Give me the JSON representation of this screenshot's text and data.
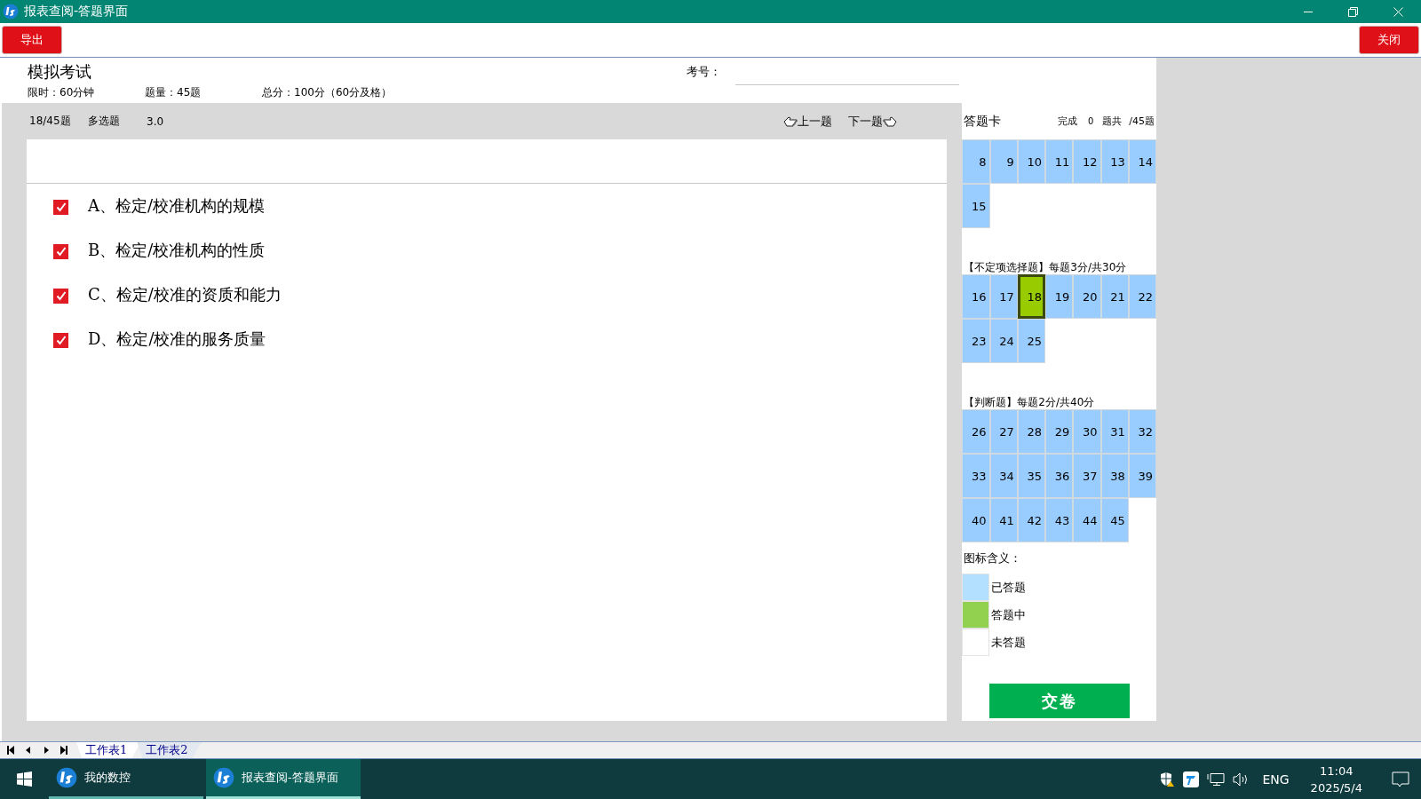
{
  "window": {
    "title": "报表查阅-答题界面"
  },
  "toolbar": {
    "export_button": "导出",
    "close_button": "关闭"
  },
  "exam": {
    "title": "模拟考试",
    "time_limit": "限时：60分钟",
    "question_count": "题量：45题",
    "total_score": "总分：100分（60分及格）",
    "exam_no_label": "考号："
  },
  "question_bar": {
    "position": "18/45题",
    "type": "多选题",
    "score": "3.0",
    "prev": "上一题",
    "next": "下一题"
  },
  "options": [
    {
      "label": "A、检定/校准机构的规模",
      "checked": true
    },
    {
      "label": "B、检定/校准机构的性质",
      "checked": true
    },
    {
      "label": "C、检定/校准的资质和能力",
      "checked": true
    },
    {
      "label": "D、检定/校准的服务质量",
      "checked": true
    }
  ],
  "answer_card": {
    "title": "答题卡",
    "done_label": "完成",
    "done_count": "0",
    "total_label": "题共",
    "total": "/45题",
    "sections": [
      {
        "cells": [
          {
            "number": "8",
            "selected": false
          },
          {
            "number": "9",
            "selected": false
          },
          {
            "number": "10",
            "selected": false
          },
          {
            "number": "11",
            "selected": false
          },
          {
            "number": "12",
            "selected": false
          },
          {
            "number": "13",
            "selected": false
          },
          {
            "number": "14",
            "selected": false
          },
          {
            "number": "15",
            "selected": false
          }
        ]
      },
      {
        "heading": "【不定项选择题】每题3分/共30分",
        "cells": [
          {
            "number": "16",
            "selected": false
          },
          {
            "number": "17",
            "selected": false
          },
          {
            "number": "18",
            "selected": true
          },
          {
            "number": "19",
            "selected": false
          },
          {
            "number": "20",
            "selected": false
          },
          {
            "number": "21",
            "selected": false
          },
          {
            "number": "22",
            "selected": false
          },
          {
            "number": "23",
            "selected": false
          },
          {
            "number": "24",
            "selected": false
          },
          {
            "number": "25",
            "selected": false
          }
        ]
      },
      {
        "heading": "【判断题】每题2分/共40分",
        "cells": [
          {
            "number": "26",
            "selected": false
          },
          {
            "number": "27",
            "selected": false
          },
          {
            "number": "28",
            "selected": false
          },
          {
            "number": "29",
            "selected": false
          },
          {
            "number": "30",
            "selected": false
          },
          {
            "number": "31",
            "selected": false
          },
          {
            "number": "32",
            "selected": false
          },
          {
            "number": "33",
            "selected": false
          },
          {
            "number": "34",
            "selected": false
          },
          {
            "number": "35",
            "selected": false
          },
          {
            "number": "36",
            "selected": false
          },
          {
            "number": "37",
            "selected": false
          },
          {
            "number": "38",
            "selected": false
          },
          {
            "number": "39",
            "selected": false
          },
          {
            "number": "40",
            "selected": false
          },
          {
            "number": "41",
            "selected": false
          },
          {
            "number": "42",
            "selected": false
          },
          {
            "number": "43",
            "selected": false
          },
          {
            "number": "44",
            "selected": false
          },
          {
            "number": "45",
            "selected": false
          }
        ]
      }
    ],
    "legend": {
      "title": "图标含义：",
      "items": [
        {
          "label": "已答题",
          "color": "#b3e0ff"
        },
        {
          "label": "答题中",
          "color": "#92d050"
        },
        {
          "label": "未答题",
          "color": "#ffffff"
        }
      ]
    },
    "submit_button": "交卷"
  },
  "sheet_tabs": [
    {
      "label": "工作表1",
      "selected": true
    },
    {
      "label": "工作表2",
      "selected": false
    }
  ],
  "taskbar": {
    "apps": [
      {
        "label": "我的数控",
        "selected": false
      },
      {
        "label": "报表查阅-答题界面",
        "selected": true
      }
    ],
    "language": "ENG",
    "time": "11:04",
    "date": "2025/5/4"
  }
}
